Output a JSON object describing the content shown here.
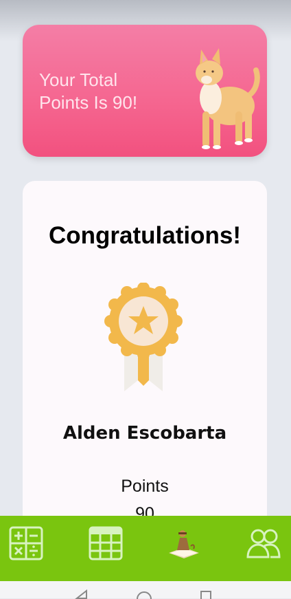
{
  "hero": {
    "text": "Your Total Points Is 90!"
  },
  "card": {
    "title": "Congratulations!",
    "name": "Alden Escobarta",
    "points_label": "Points",
    "points_value": "90"
  },
  "nav": {
    "items": [
      {
        "icon": "calculator-icon"
      },
      {
        "icon": "table-grid-icon"
      },
      {
        "icon": "reading-person-icon"
      },
      {
        "icon": "users-icon"
      }
    ]
  },
  "colors": {
    "accent_green": "#7ac50f",
    "hero_pink": "#f5658f",
    "medal_gold": "#f2b84b"
  }
}
